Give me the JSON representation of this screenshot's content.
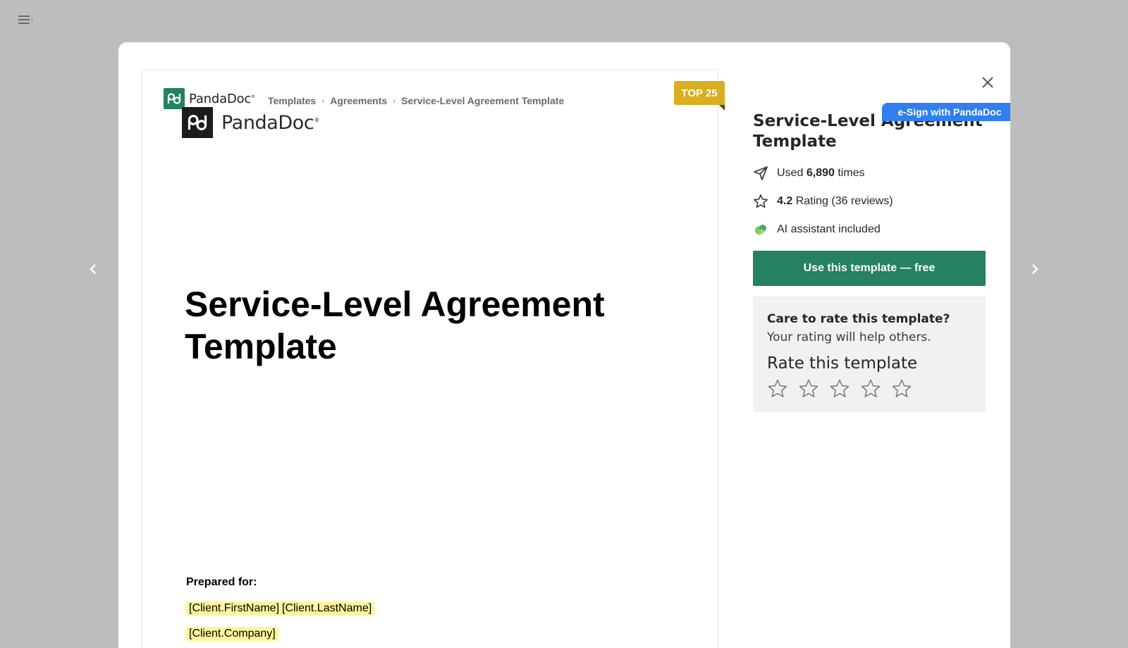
{
  "breadcrumb": {
    "brand": "PandaDoc",
    "items": [
      "Templates",
      "Agreements"
    ],
    "current": "Service-Level Agreement Template"
  },
  "preview": {
    "logo_text": "PandaDoc",
    "title": "Service-Level Agreement Template",
    "prepared_label": "Prepared for:",
    "fields": [
      "[Client.FirstName]",
      "[Client.LastName]",
      "[Client.Company]"
    ]
  },
  "badges": {
    "top": "TOP 25",
    "esign": "e-Sign with PandaDoc"
  },
  "sidebar": {
    "title": "Service-Level Agreement Template",
    "used_prefix": "Used",
    "used_count": "6,890",
    "used_suffix": "times",
    "rating_value": "4.2",
    "rating_text": "Rating (36 reviews)",
    "ai_text": "AI assistant included",
    "cta": "Use this template — free"
  },
  "rating_box": {
    "question": "Care to rate this template?",
    "help": "Your rating will help others.",
    "heading": "Rate this template",
    "star_count": 5
  },
  "colors": {
    "brand_green": "#25815f",
    "badge_gold": "#d9ae21",
    "esign_blue": "#2f7ff0",
    "field_highlight": "#fdf59b"
  }
}
